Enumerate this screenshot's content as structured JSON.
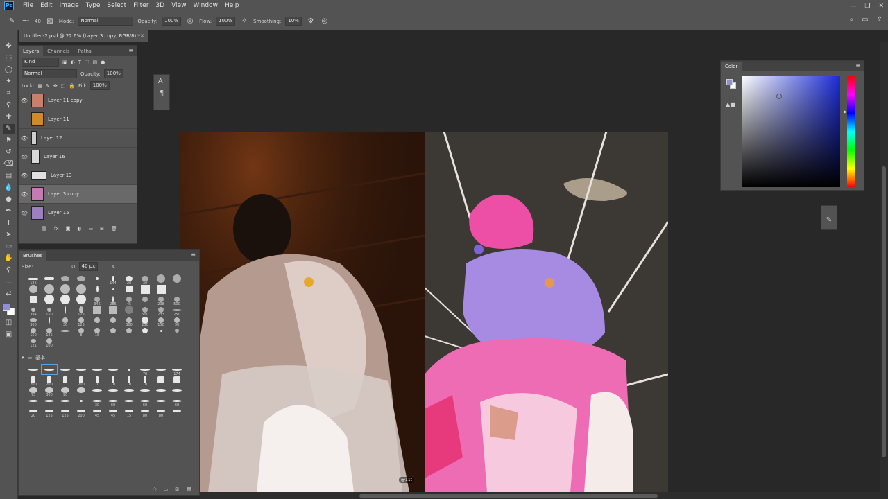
{
  "menu": [
    "File",
    "Edit",
    "Image",
    "Type",
    "Select",
    "Filter",
    "3D",
    "View",
    "Window",
    "Help"
  ],
  "app_logo": "Ps",
  "options": {
    "mode_label": "Mode:",
    "mode_value": "Normal",
    "opacity_label": "Opacity:",
    "opacity_value": "100%",
    "flow_label": "Flow:",
    "flow_value": "100%",
    "smoothing_label": "Smoothing:",
    "smoothing_value": "10%",
    "brush_size": "40"
  },
  "document_tab": "Untitled-2.psd @ 22.6% (Layer 3 copy, RGB/8) *",
  "layers_panel": {
    "tabs": [
      "Layers",
      "Channels",
      "Paths"
    ],
    "filter_value": "Kind",
    "blend_value": "Normal",
    "opacity_label": "Opacity:",
    "opacity_value": "100%",
    "lock_label": "Lock:",
    "fill_label": "Fill:",
    "fill_value": "100%",
    "layers": [
      {
        "name": "Layer 11 copy",
        "visible": true,
        "thumb": "#c9806a"
      },
      {
        "name": "Layer 11",
        "visible": false,
        "thumb": "#d08a2c"
      },
      {
        "name": "Layer 12",
        "visible": true,
        "thumb": "#cfcfcf"
      },
      {
        "name": "Layer 16",
        "visible": true,
        "thumb": "#d8d8d8"
      },
      {
        "name": "Layer 13",
        "visible": true,
        "thumb": "#e0e0e0"
      },
      {
        "name": "Layer 3 copy",
        "visible": true,
        "thumb": "#c47bb4"
      },
      {
        "name": "Layer 15",
        "visible": true,
        "thumb": "#9c7fc0"
      }
    ]
  },
  "brushes_panel": {
    "title": "Brushes",
    "size_label": "Size:",
    "size_value": "40 px",
    "group_name": "基本",
    "presets_row_labels": [
      "125",
      "144",
      "28",
      "30",
      "346",
      "285",
      "45",
      "298",
      "500",
      "394",
      "150",
      "125",
      "500",
      "233",
      "250",
      "300",
      "36",
      "125",
      "300",
      "250",
      "150",
      "90",
      "150",
      "125",
      "8",
      "15",
      "121",
      "100"
    ],
    "group_labels": [
      "70",
      "174",
      "200",
      "200",
      "200",
      "10",
      "10",
      "10",
      "10",
      "73",
      "300",
      "90",
      "30",
      "60",
      "60",
      "60",
      "20",
      "125",
      "125",
      "200",
      "45",
      "45",
      "15",
      "80",
      "80"
    ]
  },
  "color_panel": {
    "title": "Color",
    "foreground": "#8f8fd8",
    "background": "#ffffff"
  },
  "watermark": "@11t"
}
